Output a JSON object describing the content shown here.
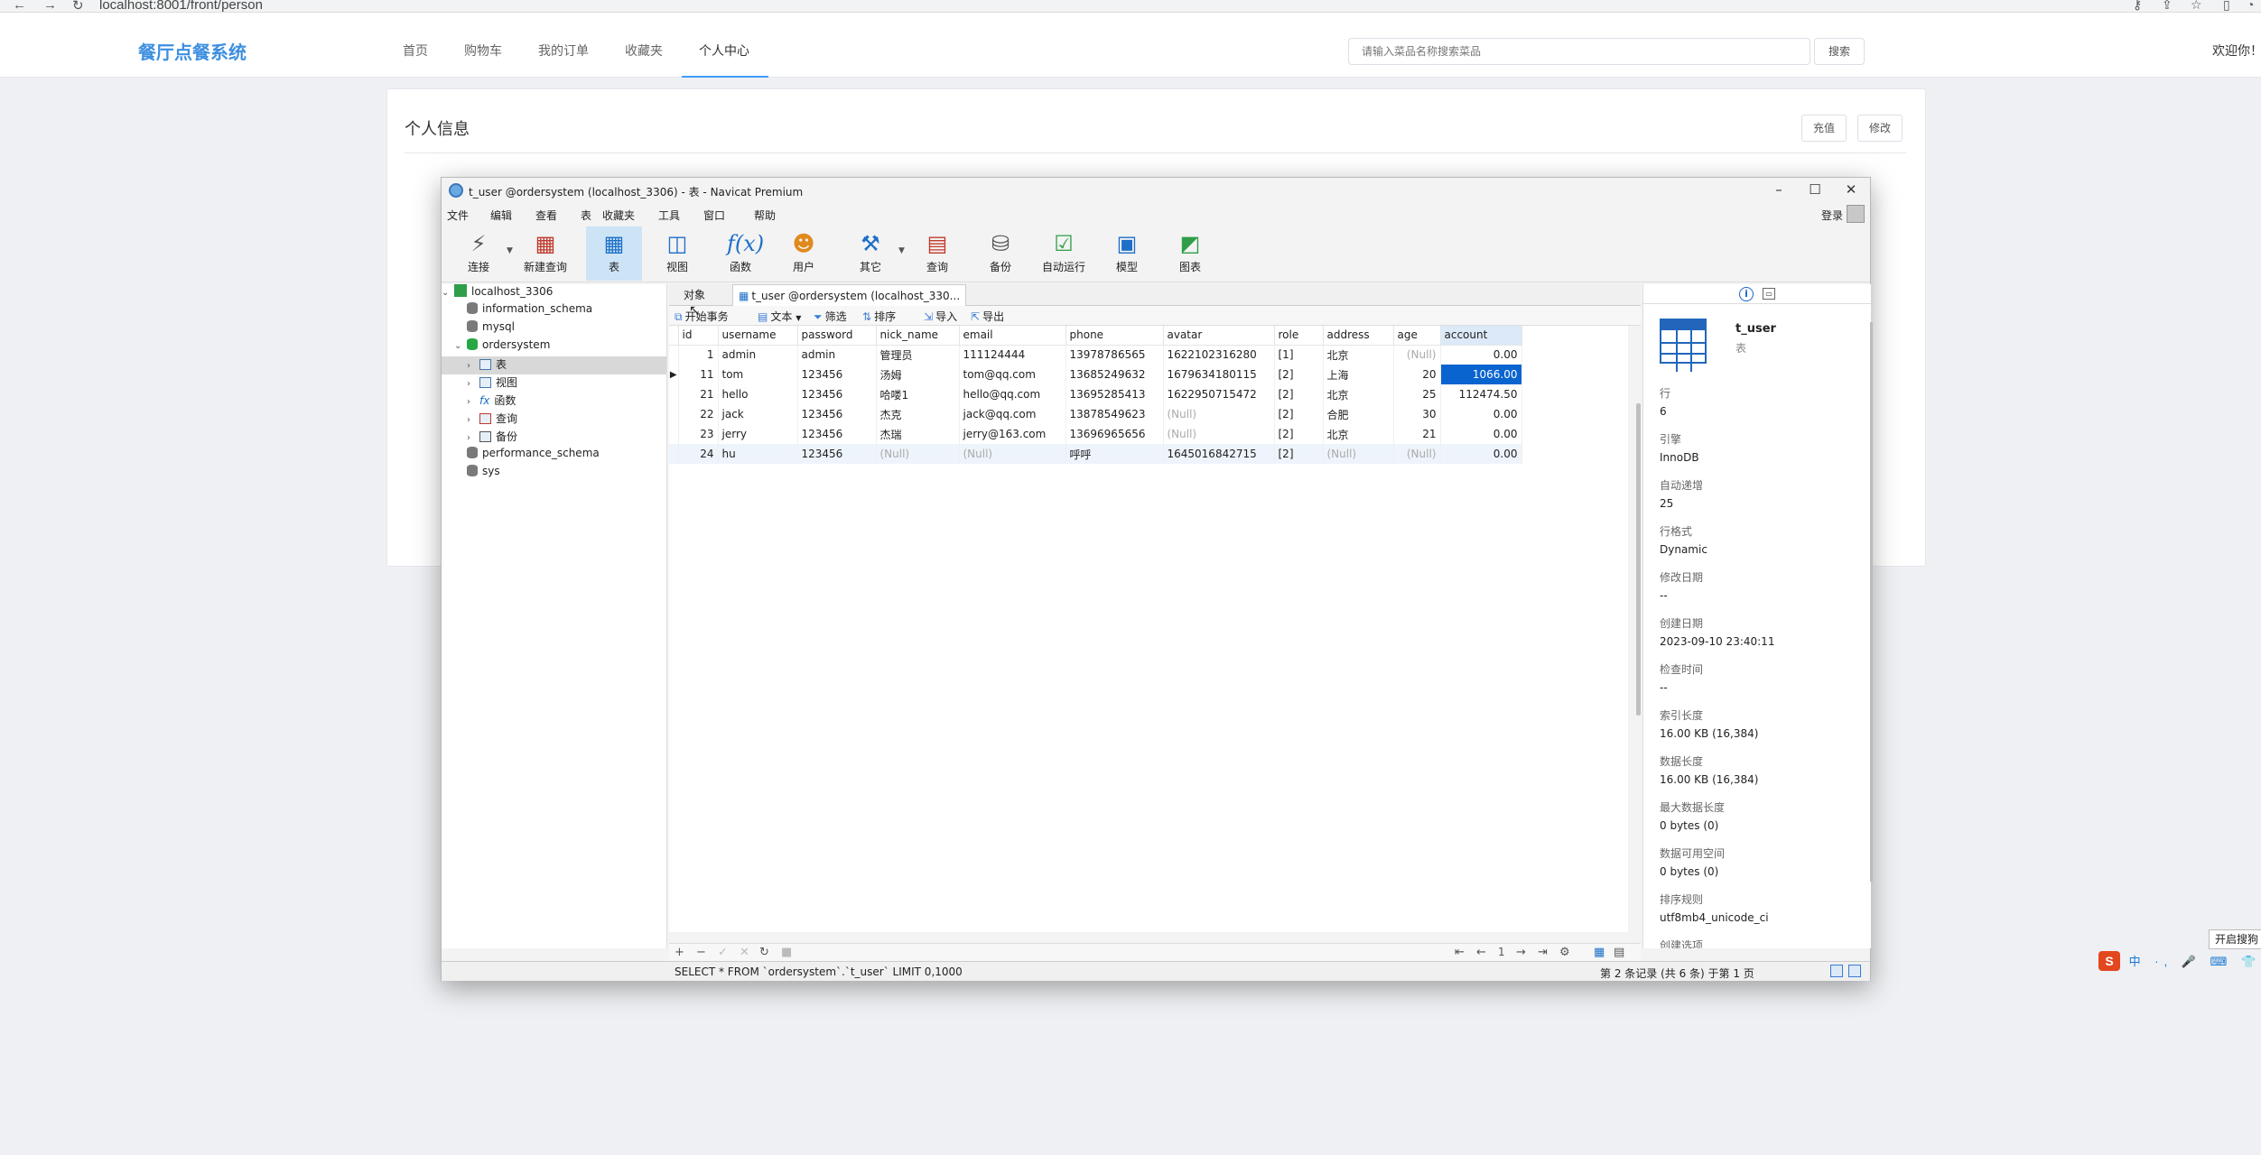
{
  "browser": {
    "url": "localhost:8001/front/person",
    "back_icon": "arrow-left-icon",
    "forward_icon": "arrow-right-icon",
    "reload_icon": "reload-icon"
  },
  "site": {
    "logo": "餐厅点餐系统",
    "nav": [
      "首页",
      "购物车",
      "我的订单",
      "收藏夹",
      "个人中心"
    ],
    "active_nav": "个人中心",
    "search_placeholder": "请输入菜品名称搜索菜品",
    "search_button": "搜索",
    "welcome": "欢迎你！",
    "accent_color": "#409eff",
    "logo_color": "#3d8fe0"
  },
  "profile_card": {
    "title": "个人信息",
    "recharge_button": "充值",
    "edit_button": "修改"
  },
  "navicat": {
    "title": "t_user @ordersystem (localhost_3306) - 表 - Navicat Premium",
    "menu": [
      "文件",
      "编辑",
      "查看",
      "表",
      "收藏夹",
      "工具",
      "窗口",
      "帮助"
    ],
    "login": "登录",
    "toolbar": [
      {
        "label": "连接",
        "icon": "plug-icon"
      },
      {
        "label": "新建查询",
        "icon": "new-query-icon"
      },
      {
        "label": "表",
        "icon": "table-icon"
      },
      {
        "label": "视图",
        "icon": "view-icon"
      },
      {
        "label": "函数",
        "icon": "function-icon"
      },
      {
        "label": "用户",
        "icon": "user-icon"
      },
      {
        "label": "其它",
        "icon": "tools-icon"
      },
      {
        "label": "查询",
        "icon": "query-icon"
      },
      {
        "label": "备份",
        "icon": "backup-icon"
      },
      {
        "label": "自动运行",
        "icon": "schedule-icon"
      },
      {
        "label": "模型",
        "icon": "model-icon"
      },
      {
        "label": "图表",
        "icon": "chart-icon"
      }
    ],
    "tree": {
      "connection": "localhost_3306",
      "databases": [
        "information_schema",
        "mysql",
        "ordersystem",
        "performance_schema",
        "sys"
      ],
      "ordersystem_children": [
        "表",
        "视图",
        "函数",
        "查询",
        "备份"
      ]
    },
    "tabs": {
      "objects": "对象",
      "active": "t_user @ordersystem (localhost_330..."
    },
    "actions": [
      "开始事务",
      "文本",
      "筛选",
      "排序",
      "导入",
      "导出"
    ],
    "columns": [
      "id",
      "username",
      "password",
      "nick_name",
      "email",
      "phone",
      "avatar",
      "role",
      "address",
      "age",
      "account"
    ],
    "rows": [
      [
        "1",
        "admin",
        "admin",
        "管理员",
        "111124444",
        "13978786565",
        "1622102316280",
        "[1]",
        "北京",
        "(Null)",
        "0.00"
      ],
      [
        "11",
        "tom",
        "123456",
        "汤姆",
        "tom@qq.com",
        "13685249632",
        "1679634180115",
        "[2]",
        "上海",
        "20",
        "1066.00"
      ],
      [
        "21",
        "hello",
        "123456",
        "哈喽1",
        "hello@qq.com",
        "13695285413",
        "1622950715472",
        "[2]",
        "北京",
        "25",
        "112474.50"
      ],
      [
        "22",
        "jack",
        "123456",
        "杰克",
        "jack@qq.com",
        "13878549623",
        "(Null)",
        "[2]",
        "合肥",
        "30",
        "0.00"
      ],
      [
        "23",
        "jerry",
        "123456",
        "杰瑞",
        "jerry@163.com",
        "13696965656",
        "(Null)",
        "[2]",
        "北京",
        "21",
        "0.00"
      ],
      [
        "24",
        "hu",
        "123456",
        "(Null)",
        "(Null)",
        "呼呼",
        "1645016842715",
        "[2]",
        "(Null)",
        "(Null)",
        "0.00"
      ]
    ],
    "page_number": "1",
    "sql": "SELECT * FROM `ordersystem`.`t_user` LIMIT 0,1000",
    "record_status": "第 2 条记录 (共 6 条) 于第 1 页",
    "info": {
      "name": "t_user",
      "type": "表",
      "props": [
        {
          "k": "行",
          "v": "6"
        },
        {
          "k": "引擎",
          "v": "InnoDB"
        },
        {
          "k": "自动递增",
          "v": "25"
        },
        {
          "k": "行格式",
          "v": "Dynamic"
        },
        {
          "k": "修改日期",
          "v": "--"
        },
        {
          "k": "创建日期",
          "v": "2023-09-10 23:40:11"
        },
        {
          "k": "检查时间",
          "v": "--"
        },
        {
          "k": "索引长度",
          "v": "16.00 KB (16,384)"
        },
        {
          "k": "数据长度",
          "v": "16.00 KB (16,384)"
        },
        {
          "k": "最大数据长度",
          "v": "0 bytes (0)"
        },
        {
          "k": "数据可用空间",
          "v": "0 bytes (0)"
        },
        {
          "k": "排序规则",
          "v": "utf8mb4_unicode_ci"
        },
        {
          "k": "创建选项",
          "v": ""
        }
      ]
    }
  },
  "ime": {
    "logo": "S",
    "status": "中 ·, 🎤 ⌨ 👕 ⋯",
    "tip": "开启搜狗"
  }
}
